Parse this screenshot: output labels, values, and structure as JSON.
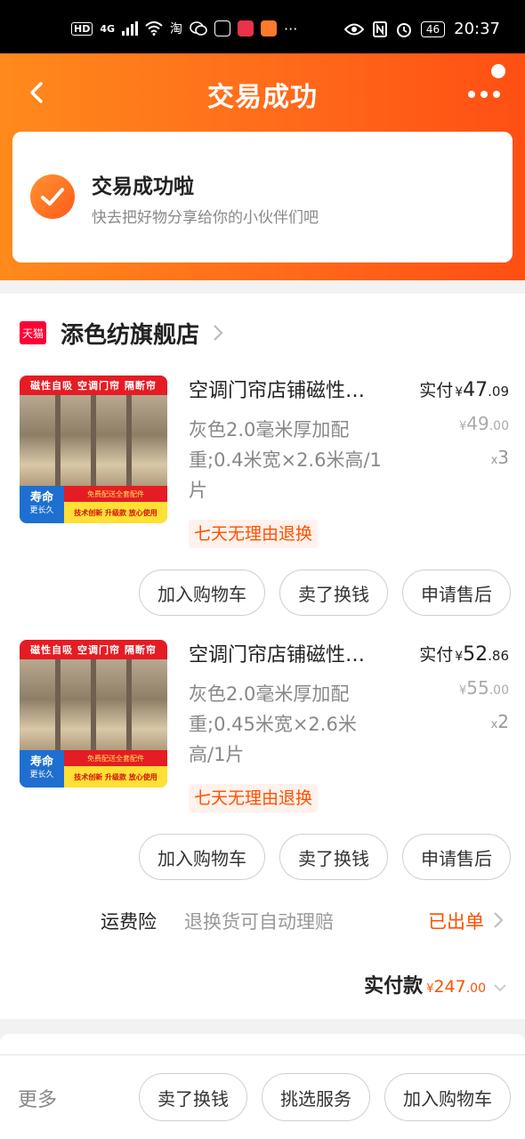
{
  "status_bar": {
    "left_icons": [
      "hd-icon",
      "signal-icon",
      "wifi-icon",
      "taobao-icon",
      "wechat-icon",
      "app-icon",
      "app-icon",
      "app-icon"
    ],
    "hd": "HD",
    "signal": "4G",
    "taobao": "淘",
    "overflow": "···",
    "battery": "46",
    "time": "20:37"
  },
  "header": {
    "title": "交易成功",
    "success_title": "交易成功啦",
    "success_subtitle": "快去把好物分享给你的小伙伴们吧"
  },
  "store": {
    "badge": "天猫",
    "name": "添色纺旗舰店"
  },
  "items": [
    {
      "title": "空调门帘店铺磁性自吸门帘",
      "spec": "灰色2.0毫米厚加配重;0.4米宽×2.6米高/1片",
      "paid_label": "实付",
      "currency": "¥",
      "paid_int": "47",
      "paid_dec": ".09",
      "orig_int": "49",
      "orig_dec": ".00",
      "qty_x": "x",
      "qty": "3",
      "tag": "七天无理由退换",
      "thumb": {
        "band_top": "磁性自吸  空调门帘  隔断帘",
        "life": "寿命",
        "life_sub": "更长久",
        "band2": "免费配送全套配件",
        "band3": "技术创新 升级款 放心使用"
      },
      "buttons": [
        "加入购物车",
        "卖了换钱",
        "申请售后"
      ]
    },
    {
      "title": "空调门帘店铺磁性自吸门帘",
      "spec": "灰色2.0毫米厚加配重;0.45米宽×2.6米高/1片",
      "paid_label": "实付",
      "currency": "¥",
      "paid_int": "52",
      "paid_dec": ".86",
      "orig_int": "55",
      "orig_dec": ".00",
      "qty_x": "x",
      "qty": "2",
      "tag": "七天无理由退换",
      "thumb": {
        "band_top": "磁性自吸  空调门帘  隔断帘",
        "life": "寿命",
        "life_sub": "更长久",
        "band2": "免费配送全套配件",
        "band3": "技术创新 升级款 放心使用"
      },
      "buttons": [
        "加入购物车",
        "卖了换钱",
        "申请售后"
      ]
    }
  ],
  "insurance": {
    "label": "运费险",
    "desc": "退换货可自动理赔",
    "status": "已出单"
  },
  "total": {
    "label": "实付款",
    "currency": "¥",
    "int": "247",
    "dec": ".00"
  },
  "bottom_bar": {
    "more": "更多",
    "buttons": [
      "卖了换钱",
      "挑选服务",
      "加入购物车"
    ]
  },
  "colors": {
    "accent": "#ff5000",
    "header_start": "#ff8a1c",
    "header_end": "#ff4f14",
    "tmall": "#ff0036"
  }
}
